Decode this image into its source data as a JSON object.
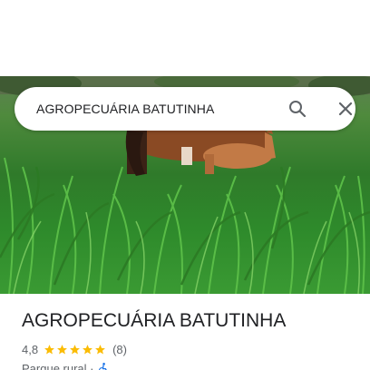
{
  "search": {
    "query": "AGROPECUÁRIA BATUTINHA",
    "search_icon": "search-icon",
    "close_icon": "close-icon"
  },
  "hero_image": {
    "icon": "photo-icon"
  },
  "place": {
    "title": "AGROPECUÁRIA BATUTINHA",
    "rating": "4,8",
    "stars": 5,
    "review_count": "(8)",
    "category": "Parque rural ·",
    "accessibility_icon": "wheelchair-accessible-icon"
  },
  "colors": {
    "star": "#fbbc04",
    "accessibility": "#1a73e8",
    "title": "#202124",
    "secondary": "#5f6368"
  }
}
